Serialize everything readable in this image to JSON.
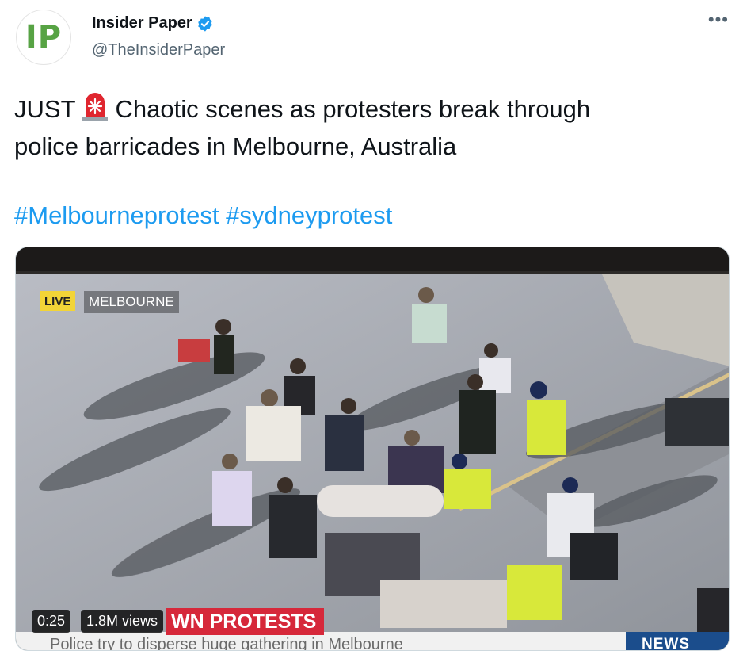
{
  "author": {
    "avatar_text": "IP",
    "display_name": "Insider Paper",
    "handle": "@TheInsiderPaper"
  },
  "tweet": {
    "prefix": "JUST",
    "emoji_icon": "rotating-light-icon",
    "line1": "Chaotic scenes as protesters break through",
    "line2": "police barricades in Melbourne, Australia",
    "hashtags": [
      "#Melbourneprotest",
      "#sydneyprotest"
    ]
  },
  "video": {
    "live_label": "LIVE",
    "location_label": "MELBOURNE",
    "headline": "WN PROTESTS",
    "ticker": "Police try to disperse huge gathering in Melbourne",
    "news_logo": "NEWS",
    "duration": "0:25",
    "views": "1.8M views"
  },
  "colors": {
    "link": "#1d9bf0",
    "verified": "#1d9bf0",
    "headline_bg": "#d6283a",
    "live_bg": "#f2d437",
    "avatar_letters": "#57a344"
  }
}
